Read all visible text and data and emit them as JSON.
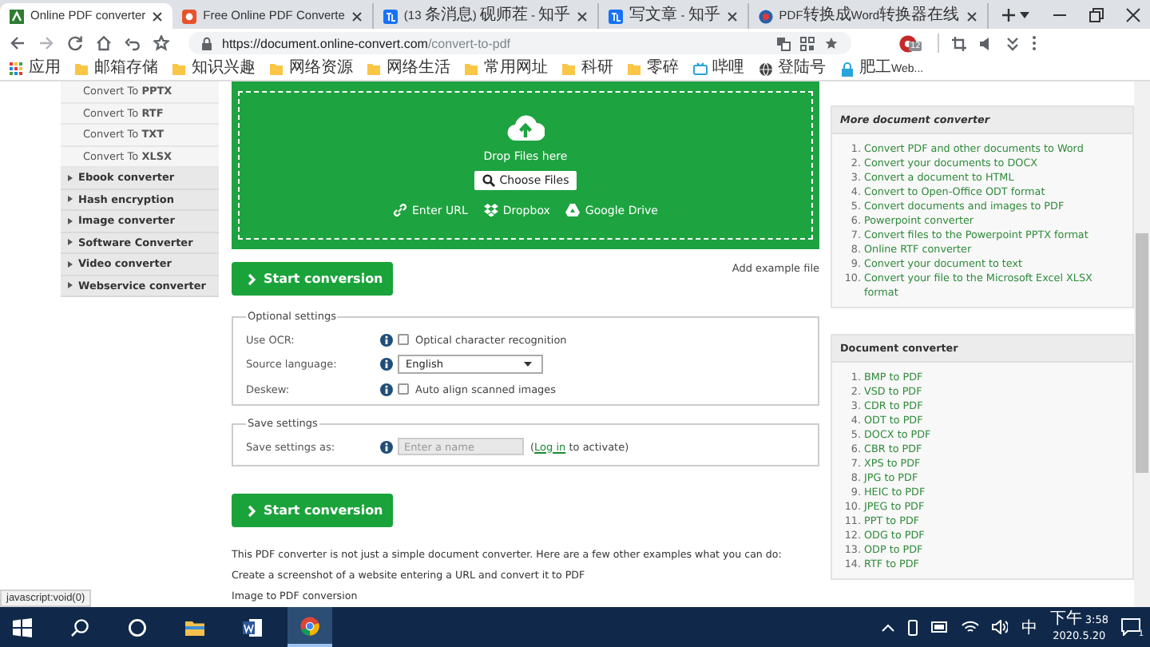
{
  "browser": {
    "tabs": [
      {
        "title": "Online PDF converter",
        "selected": true,
        "kind": "green"
      },
      {
        "title": "Free Online PDF Converte",
        "selected": false,
        "kind": "orange"
      },
      {
        "title": "(13 条消息) 砚师茬 - 知乎",
        "selected": false,
        "kind": "blue"
      },
      {
        "title": "写文章 - 知乎",
        "selected": false,
        "kind": "blue"
      },
      {
        "title": "PDF转换成Word转换器在线",
        "selected": false,
        "kind": "round"
      }
    ],
    "address": {
      "host": "https://document.online-convert.com",
      "path": "/convert-to-pdf"
    },
    "profile_badge": "12",
    "bookmarks": [
      {
        "label": "应用",
        "kind": "apps"
      },
      {
        "label": "邮箱存储",
        "kind": "folder"
      },
      {
        "label": "知识兴趣",
        "kind": "folder"
      },
      {
        "label": "网络资源",
        "kind": "folder"
      },
      {
        "label": "网络生活",
        "kind": "folder"
      },
      {
        "label": "常用网址",
        "kind": "folder"
      },
      {
        "label": "科研",
        "kind": "folder"
      },
      {
        "label": "零碎",
        "kind": "folder"
      },
      {
        "label": "哔哩",
        "kind": "tv"
      },
      {
        "label": "登陆号",
        "kind": "globe"
      },
      {
        "label": "肥工Web...",
        "kind": "lock"
      }
    ]
  },
  "sidebar": {
    "subitems": [
      "Convert To **PPTX**",
      "Convert To **RTF**",
      "Convert To **TXT**",
      "Convert To **XLSX**"
    ],
    "categories": [
      {
        "label": "Ebook converter",
        "expanded": false
      },
      {
        "label": "Hash encryption",
        "expanded": false
      },
      {
        "label": "Image converter",
        "expanded": false
      },
      {
        "label": "Software Converter",
        "expanded": false
      },
      {
        "label": "Video converter",
        "expanded": false
      },
      {
        "label": "Webservice converter",
        "expanded": false
      }
    ]
  },
  "upload": {
    "drop_text": "Drop Files here",
    "choose_button": "Choose Files",
    "sources": [
      {
        "label": "Enter URL",
        "kind": "url"
      },
      {
        "label": "Dropbox",
        "kind": "dropbox"
      },
      {
        "label": "Google Drive",
        "kind": "drive"
      }
    ]
  },
  "start_button": "Start conversion",
  "add_example": "Add example file",
  "optional_settings": {
    "legend": "Optional settings",
    "rows": [
      {
        "label": "Use OCR:",
        "kind": "checkbox",
        "text": "Optical character recognition",
        "checked": false
      },
      {
        "label": "Source language:",
        "kind": "select",
        "value": "English"
      },
      {
        "label": "Deskew:",
        "kind": "checkbox",
        "text": "Auto align scanned images",
        "checked": false
      }
    ]
  },
  "save_settings": {
    "legend": "Save settings",
    "label": "Save settings as:",
    "placeholder": "Enter a name",
    "note_before": "(",
    "note_link": "Log in",
    "note_after": " to activate)"
  },
  "start_button_bottom": "Start conversion",
  "intro": "This PDF converter is not just a simple document converter. Here are a few other examples what you can do:",
  "examples": [
    "Create a screenshot of a website entering a URL and convert it to PDF",
    "Image to PDF conversion"
  ],
  "panels": [
    {
      "title": "More document converter",
      "items": [
        {
          "n": "1.",
          "label": "Convert PDF and other documents to Word"
        },
        {
          "n": "2.",
          "label": "Convert your documents to DOCX"
        },
        {
          "n": "3.",
          "label": "Convert a document to HTML"
        },
        {
          "n": "4.",
          "label": "Convert to Open-Office ODT format"
        },
        {
          "n": "5.",
          "label": "Convert documents and images to PDF"
        },
        {
          "n": "6.",
          "label": "Powerpoint converter"
        },
        {
          "n": "7.",
          "label": "Convert files to the Powerpoint PPTX format"
        },
        {
          "n": "8.",
          "label": "Online RTF converter"
        },
        {
          "n": "9.",
          "label": "Convert your document to text"
        },
        {
          "n": "10.",
          "label": "Convert your file to the Microsoft Excel XLSX format"
        }
      ]
    },
    {
      "title": "Document converter",
      "items": [
        {
          "n": "1.",
          "label": "BMP to PDF"
        },
        {
          "n": "2.",
          "label": "VSD to PDF"
        },
        {
          "n": "3.",
          "label": "CDR to PDF"
        },
        {
          "n": "4.",
          "label": "ODT to PDF"
        },
        {
          "n": "5.",
          "label": "DOCX to PDF"
        },
        {
          "n": "6.",
          "label": "CBR to PDF"
        },
        {
          "n": "7.",
          "label": "XPS to PDF"
        },
        {
          "n": "8.",
          "label": "JPG to PDF"
        },
        {
          "n": "9.",
          "label": "HEIC to PDF"
        },
        {
          "n": "10.",
          "label": "JPEG to PDF"
        },
        {
          "n": "11.",
          "label": "PPT to PDF"
        },
        {
          "n": "12.",
          "label": "ODG to PDF"
        },
        {
          "n": "13.",
          "label": "ODP to PDF"
        },
        {
          "n": "14.",
          "label": "RTF to PDF"
        }
      ]
    }
  ],
  "status_url": "javascript:void(0)",
  "taskbar": {
    "apps": [
      {
        "kind": "start",
        "active": false
      },
      {
        "kind": "search",
        "active": false
      },
      {
        "kind": "cortana",
        "active": false
      },
      {
        "kind": "explorer",
        "active": false
      },
      {
        "kind": "word",
        "active": false
      },
      {
        "kind": "chrome",
        "active": true
      }
    ],
    "ime": "中",
    "time": "下午 3:58",
    "date": "2020.5.20",
    "notifications": "1"
  }
}
